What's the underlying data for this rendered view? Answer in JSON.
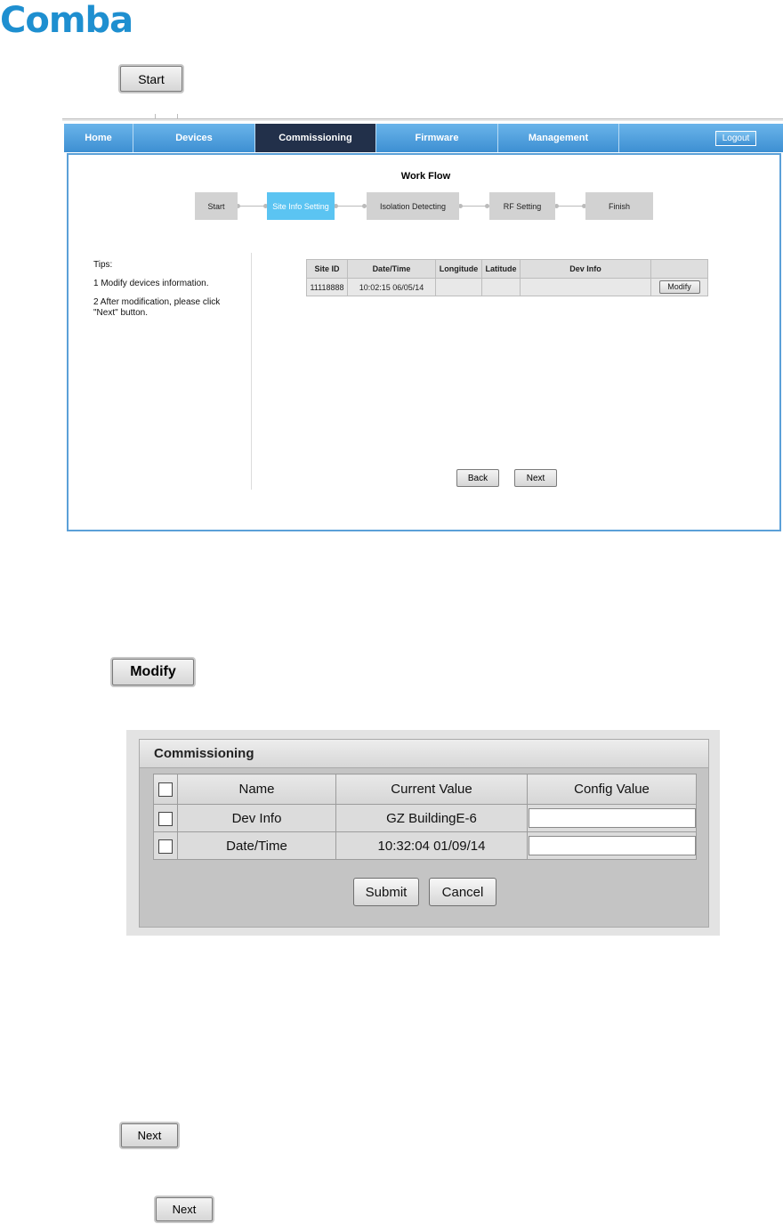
{
  "logo": {
    "text": "Comba"
  },
  "start_button": {
    "label": "Start"
  },
  "nav": {
    "tabs": [
      {
        "label": "Home"
      },
      {
        "label": "Devices"
      },
      {
        "label": "Commissioning"
      },
      {
        "label": "Firmware"
      },
      {
        "label": "Management"
      }
    ],
    "active": "Commissioning",
    "logout_label": "Logout"
  },
  "workflow": {
    "title": "Work Flow",
    "steps": [
      "Start",
      "Site Info Setting",
      "Isolation Detecting",
      "RF Setting",
      "Finish"
    ],
    "active_step": "Site Info Setting"
  },
  "tips": {
    "heading": "Tips:",
    "items": [
      "1 Modify devices information.",
      "2 After modification, please click \"Next\" button."
    ]
  },
  "site_table": {
    "headers": [
      "Site ID",
      "Date/Time",
      "Longitude",
      "Latitude",
      "Dev Info",
      ""
    ],
    "row": {
      "site_id": "11118888",
      "date_time": "10:02:15 06/05/14",
      "longitude": "",
      "latitude": "",
      "dev_info": "",
      "action": "Modify"
    }
  },
  "wizard_buttons": {
    "back": "Back",
    "next": "Next"
  },
  "modify_button": {
    "label": "Modify"
  },
  "dialog": {
    "title": "Commissioning",
    "headers": [
      "Name",
      "Current Value",
      "Config Value"
    ],
    "rows": [
      {
        "name": "Dev Info",
        "current": "GZ BuildingE-6",
        "config": ""
      },
      {
        "name": "Date/Time",
        "current": "10:32:04 01/09/14",
        "config": ""
      }
    ],
    "submit_label": "Submit",
    "cancel_label": "Cancel"
  },
  "next_buttons": [
    {
      "label": "Next"
    },
    {
      "label": "Next"
    }
  ],
  "colors": {
    "nav_blue": "#3d8fd2",
    "nav_active": "#22304a",
    "step_active": "#5bc4f2",
    "logo": "#1e8fd0"
  }
}
